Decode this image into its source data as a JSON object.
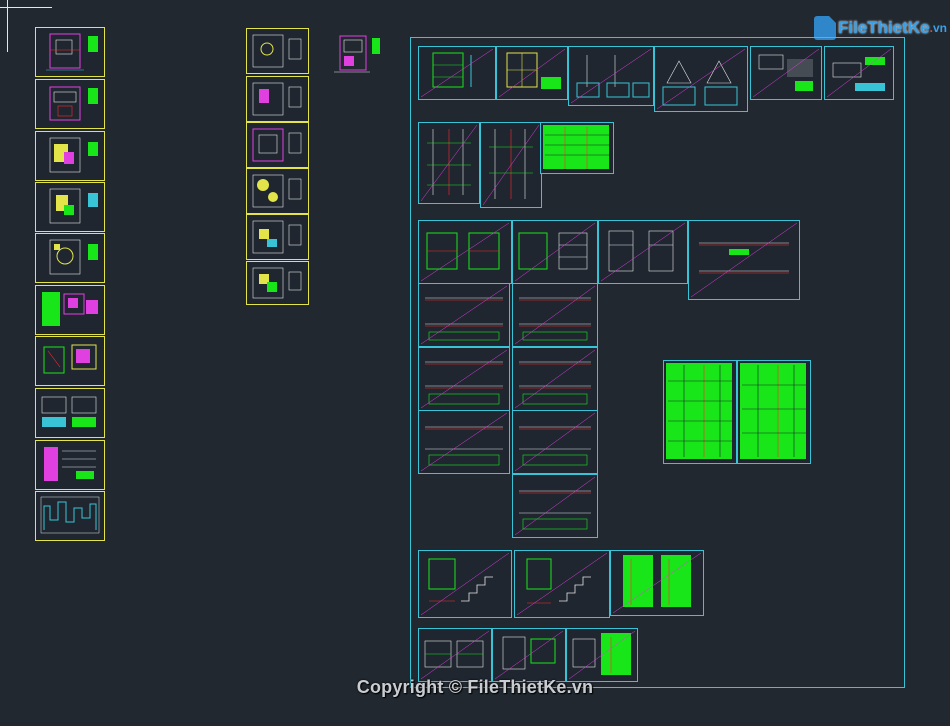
{
  "watermark": {
    "text": "Copyright © FileThietKe.vn"
  },
  "logo": {
    "name": "FileThietKe",
    "domain_dot": ".",
    "domain_tld": "vn"
  },
  "colors": {
    "background": "#212830",
    "frame_yellow": "#e3e34a",
    "frame_cyan": "#38c4d6",
    "cad_green": "#19e619",
    "cad_red": "#ff2a2a",
    "cad_magenta": "#e040e0",
    "cad_white": "#e6e6e6"
  },
  "sheet_groups": {
    "architecture_column": {
      "count": 10,
      "frame": "yellow"
    },
    "electrical_column": {
      "count": 6,
      "frame": "yellow"
    },
    "loose_plan": {
      "count": 1,
      "frame": "none"
    },
    "structure_group": {
      "count": 29,
      "frame": "cyan"
    }
  }
}
